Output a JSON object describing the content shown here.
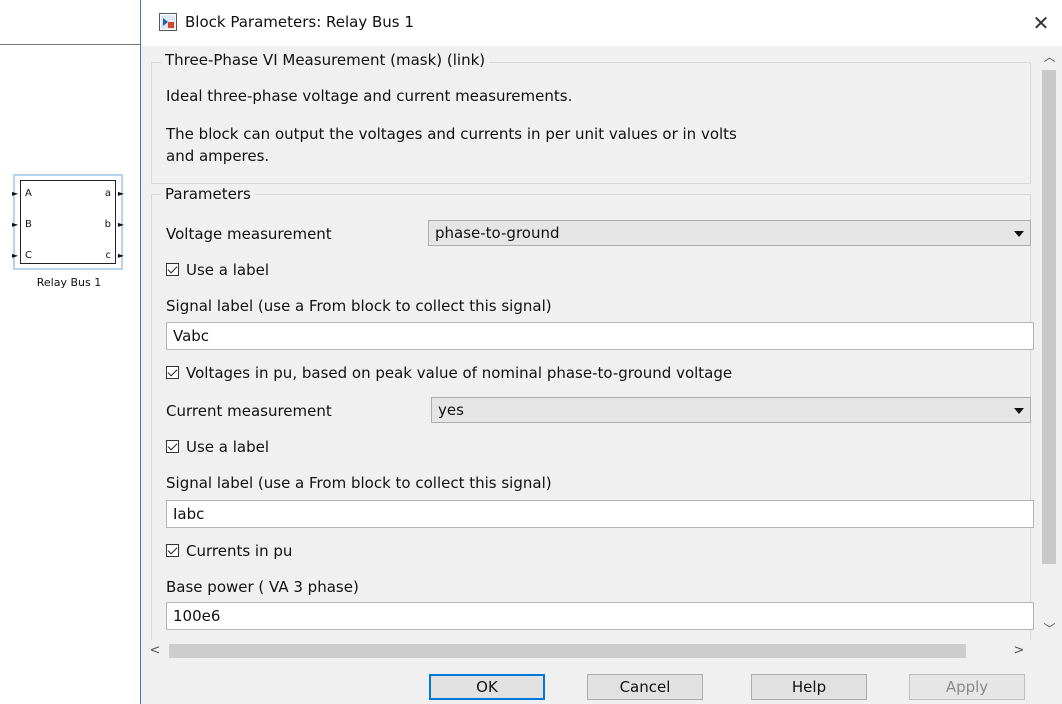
{
  "canvas": {
    "block": {
      "name": "Relay Bus 1",
      "inputs": [
        "A",
        "B",
        "C"
      ],
      "outputs": [
        "a",
        "b",
        "c"
      ]
    }
  },
  "dialog": {
    "title": "Block Parameters: Relay Bus 1",
    "close_symbol": "✕",
    "mask": {
      "legend": "Three-Phase VI Measurement (mask) (link)",
      "description_1": "Ideal three-phase voltage and current measurements.",
      "description_2_line1": "The block can output the voltages and currents in per unit values or in volts",
      "description_2_line2": "and amperes."
    },
    "parameters": {
      "legend": "Parameters",
      "voltage_measurement_label": "Voltage measurement",
      "voltage_measurement_value": "phase-to-ground",
      "use_label_1": "Use a label",
      "signal_label_1_caption": "Signal label  (use a From block to collect this signal)",
      "signal_label_1_value": "Vabc",
      "voltages_pu_label": "Voltages in pu,  based on peak value of nominal phase-to-ground voltage",
      "current_measurement_label": "Current measurement",
      "current_measurement_value": "yes",
      "use_label_2": "Use a label",
      "signal_label_2_caption": "Signal label  (use a From block to collect this signal)",
      "signal_label_2_value": "Iabc",
      "currents_pu_label": "Currents in pu",
      "base_power_caption": "Base power ( VA 3 phase)",
      "base_power_value": "100e6"
    },
    "buttons": {
      "ok": "OK",
      "cancel": "Cancel",
      "help": "Help",
      "apply": "Apply"
    }
  },
  "colors": {
    "dialog_bg": "#f0f0f0",
    "default_button_border": "#0078d7",
    "block_highlight": "#b9d4ee"
  }
}
